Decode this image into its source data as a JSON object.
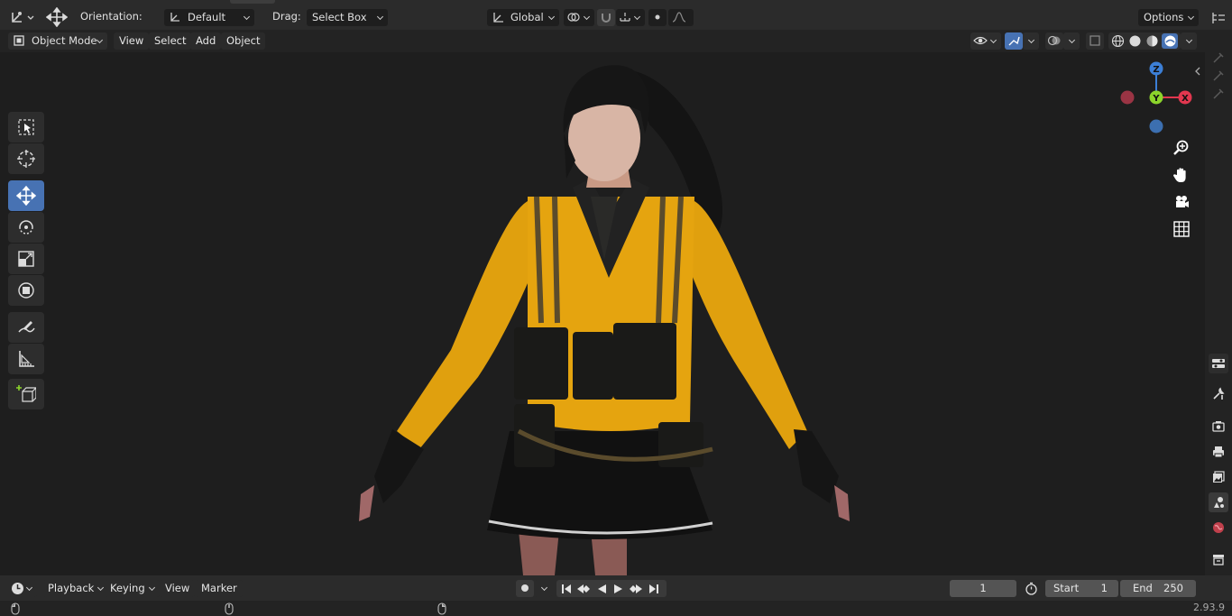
{
  "header": {
    "orientation_label": "Orientation:",
    "orientation_value": "Default",
    "drag_label": "Drag:",
    "drag_value": "Select Box",
    "transform_orientation": "Global",
    "options_label": "Options"
  },
  "viewport_header": {
    "mode": "Object Mode",
    "menus": [
      "View",
      "Select",
      "Add",
      "Object"
    ]
  },
  "gizmo": {
    "z": "Z",
    "y": "Y",
    "x": "X"
  },
  "timeline": {
    "menus": [
      "Playback",
      "Keying",
      "View",
      "Marker"
    ],
    "current_frame": "1",
    "start_label": "Start",
    "start_value": "1",
    "end_label": "End",
    "end_value": "250"
  },
  "status": {
    "version": "2.93.9"
  },
  "colors": {
    "accent": "#4772b3",
    "jacket": "#e0a00e",
    "axis_x": "#e2374f",
    "axis_y": "#8bd42b",
    "axis_z": "#3c7fd6"
  },
  "icons": {
    "toolbar": [
      "select-box-icon",
      "cursor-icon",
      "move-icon",
      "rotate-icon",
      "scale-icon",
      "transform-icon",
      "annotate-icon",
      "measure-icon",
      "add-cube-icon"
    ],
    "properties": [
      "tool-icon",
      "render-icon",
      "output-icon",
      "view-layer-icon",
      "scene-icon",
      "world-icon",
      "collection-icon"
    ]
  }
}
